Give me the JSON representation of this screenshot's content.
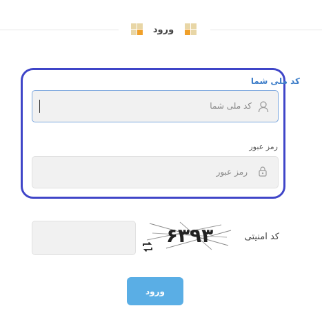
{
  "header": {
    "title": "ورود",
    "accent_colors": [
      "#f0a02a",
      "#e8d6a6"
    ]
  },
  "form": {
    "national_code": {
      "label": "کد ملی شما",
      "placeholder": "کد ملی شما",
      "value": "",
      "icon": "user-icon"
    },
    "password": {
      "label": "رمز عبور",
      "placeholder": "رمز عبور",
      "value": "",
      "icon": "lock-icon"
    },
    "captcha": {
      "label": "کد امنیتی",
      "value": "",
      "image_text": "۶۳۹۳",
      "refresh_icon": "refresh-icon"
    },
    "submit_label": "ورود"
  },
  "colors": {
    "card_border": "#3f45c8",
    "active_label": "#3e7ec9",
    "button": "#5aaee5"
  }
}
